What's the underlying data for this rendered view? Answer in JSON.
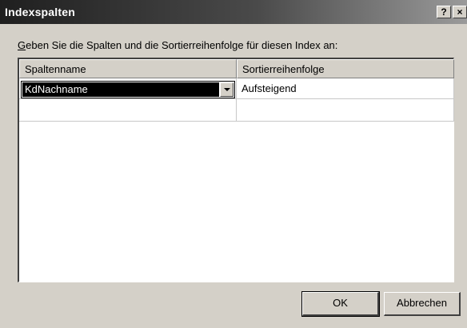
{
  "window": {
    "title": "Indexspalten",
    "help_button": "?",
    "close_button": "×"
  },
  "instruction": {
    "accel": "G",
    "rest": "eben Sie die Spalten und die Sortierreihenfolge für diesen Index an:"
  },
  "grid": {
    "columns": [
      "Spaltenname",
      "Sortierreihenfolge"
    ],
    "rows": [
      {
        "column": "KdNachname",
        "order": "Aufsteigend"
      },
      {
        "column": "",
        "order": ""
      }
    ]
  },
  "buttons": {
    "ok": "OK",
    "cancel": "Abbrechen"
  }
}
